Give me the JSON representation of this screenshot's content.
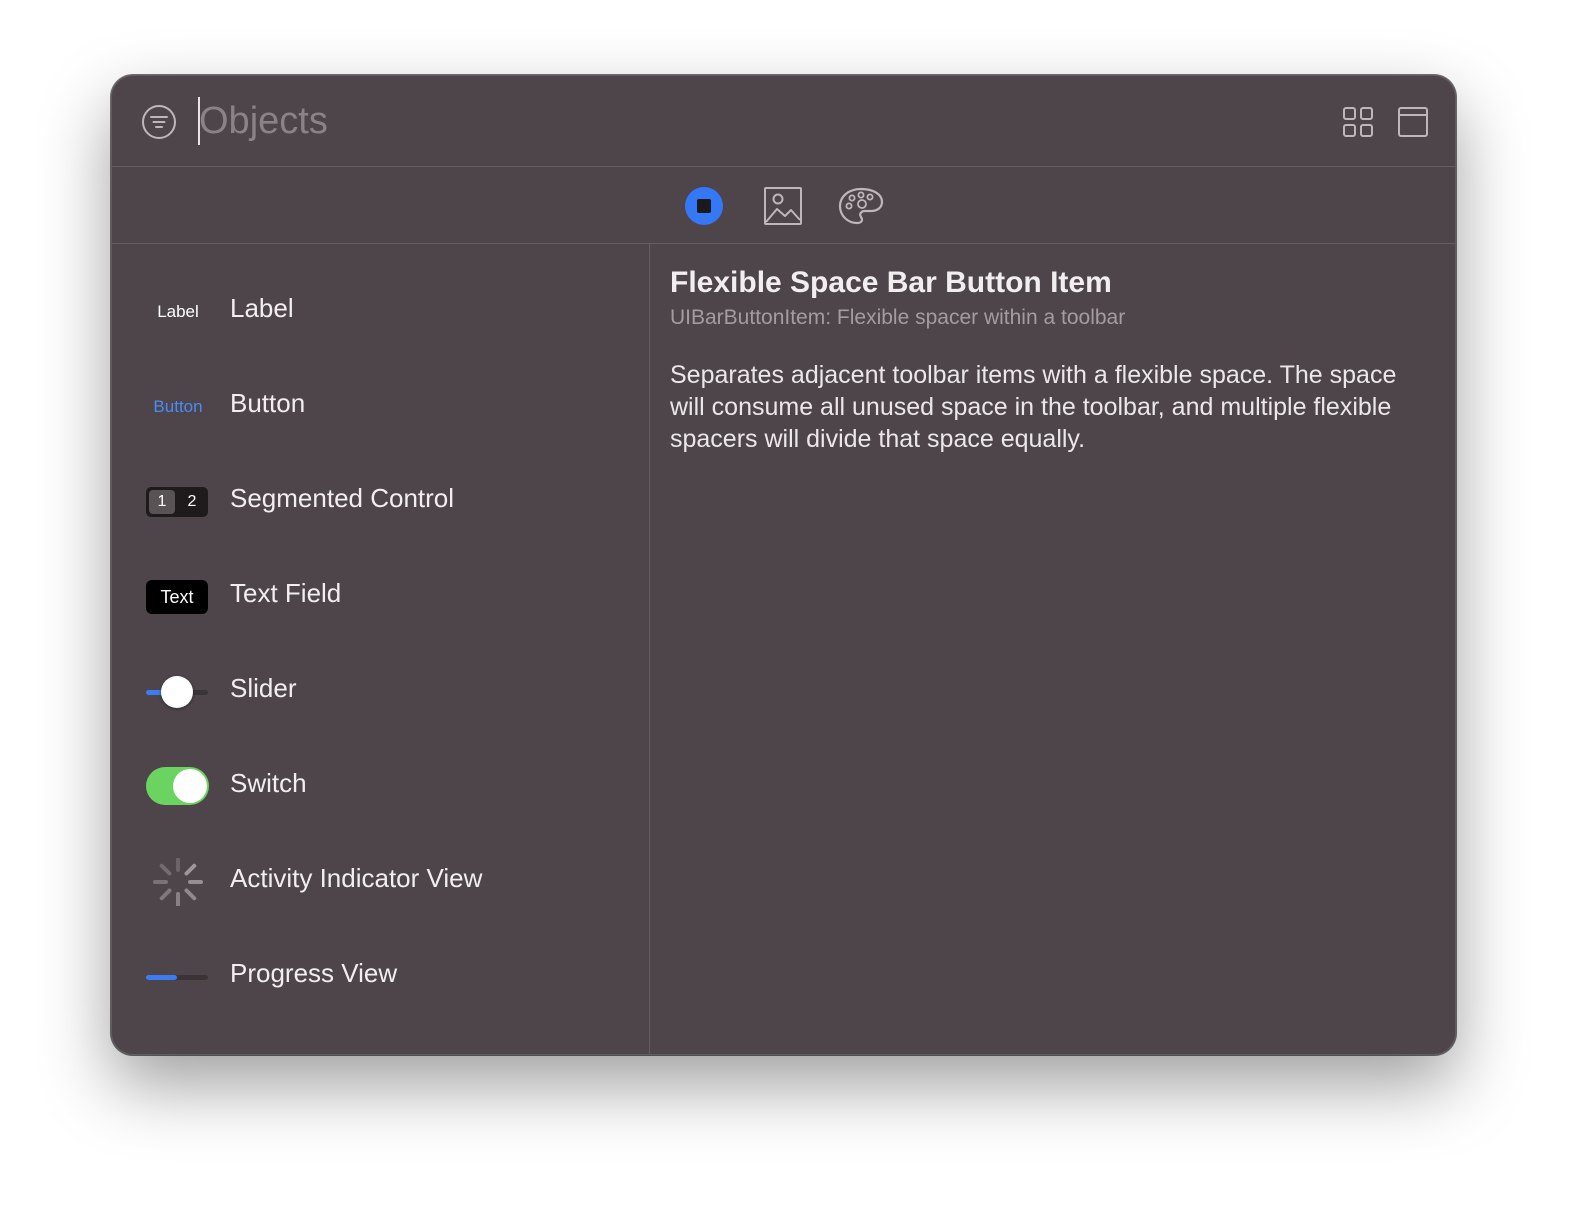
{
  "search": {
    "placeholder": "Objects",
    "value": ""
  },
  "header": {
    "filter_icon": "filter-icon",
    "grid_view_icon": "grid-icon",
    "window_view_icon": "window-icon"
  },
  "library_tabs": [
    {
      "name": "objects",
      "icon": "objects-icon",
      "selected": true
    },
    {
      "name": "media",
      "icon": "image-icon",
      "selected": false
    },
    {
      "name": "colors",
      "icon": "palette-icon",
      "selected": false
    }
  ],
  "object_list": {
    "items": [
      {
        "label": "Label",
        "icon": "label-icon",
        "icon_text": "Label"
      },
      {
        "label": "Button",
        "icon": "button-icon",
        "icon_text": "Button"
      },
      {
        "label": "Segmented Control",
        "icon": "segmented-control-icon",
        "segments": [
          "1",
          "2"
        ]
      },
      {
        "label": "Text Field",
        "icon": "text-field-icon",
        "icon_text": "Text"
      },
      {
        "label": "Slider",
        "icon": "slider-icon",
        "value_fraction": 0.5
      },
      {
        "label": "Switch",
        "icon": "switch-icon",
        "on": true
      },
      {
        "label": "Activity Indicator View",
        "icon": "activity-indicator-icon"
      },
      {
        "label": "Progress View",
        "icon": "progress-view-icon",
        "progress_fraction": 0.5
      }
    ]
  },
  "detail": {
    "title": "Flexible Space Bar Button Item",
    "subtitle": "UIBarButtonItem: Flexible spacer within a toolbar",
    "description": "Separates adjacent toolbar items with a flexible space. The space will consume all unused space in the toolbar, and multiple flexible spacers will divide that space equally."
  },
  "colors": {
    "accent": "#3478f6",
    "switch_on": "#6bd35f",
    "window_bg": "#4d4549"
  }
}
